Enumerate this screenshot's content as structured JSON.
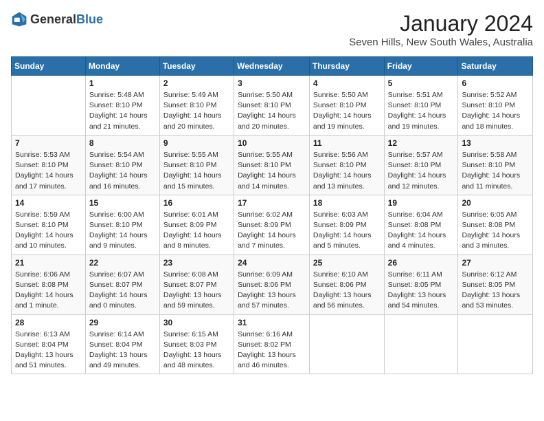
{
  "logo": {
    "general": "General",
    "blue": "Blue"
  },
  "title": "January 2024",
  "subtitle": "Seven Hills, New South Wales, Australia",
  "days_of_week": [
    "Sunday",
    "Monday",
    "Tuesday",
    "Wednesday",
    "Thursday",
    "Friday",
    "Saturday"
  ],
  "weeks": [
    [
      {
        "day": "",
        "info": ""
      },
      {
        "day": "1",
        "info": "Sunrise: 5:48 AM\nSunset: 8:10 PM\nDaylight: 14 hours\nand 21 minutes."
      },
      {
        "day": "2",
        "info": "Sunrise: 5:49 AM\nSunset: 8:10 PM\nDaylight: 14 hours\nand 20 minutes."
      },
      {
        "day": "3",
        "info": "Sunrise: 5:50 AM\nSunset: 8:10 PM\nDaylight: 14 hours\nand 20 minutes."
      },
      {
        "day": "4",
        "info": "Sunrise: 5:50 AM\nSunset: 8:10 PM\nDaylight: 14 hours\nand 19 minutes."
      },
      {
        "day": "5",
        "info": "Sunrise: 5:51 AM\nSunset: 8:10 PM\nDaylight: 14 hours\nand 19 minutes."
      },
      {
        "day": "6",
        "info": "Sunrise: 5:52 AM\nSunset: 8:10 PM\nDaylight: 14 hours\nand 18 minutes."
      }
    ],
    [
      {
        "day": "7",
        "info": "Sunrise: 5:53 AM\nSunset: 8:10 PM\nDaylight: 14 hours\nand 17 minutes."
      },
      {
        "day": "8",
        "info": "Sunrise: 5:54 AM\nSunset: 8:10 PM\nDaylight: 14 hours\nand 16 minutes."
      },
      {
        "day": "9",
        "info": "Sunrise: 5:55 AM\nSunset: 8:10 PM\nDaylight: 14 hours\nand 15 minutes."
      },
      {
        "day": "10",
        "info": "Sunrise: 5:55 AM\nSunset: 8:10 PM\nDaylight: 14 hours\nand 14 minutes."
      },
      {
        "day": "11",
        "info": "Sunrise: 5:56 AM\nSunset: 8:10 PM\nDaylight: 14 hours\nand 13 minutes."
      },
      {
        "day": "12",
        "info": "Sunrise: 5:57 AM\nSunset: 8:10 PM\nDaylight: 14 hours\nand 12 minutes."
      },
      {
        "day": "13",
        "info": "Sunrise: 5:58 AM\nSunset: 8:10 PM\nDaylight: 14 hours\nand 11 minutes."
      }
    ],
    [
      {
        "day": "14",
        "info": "Sunrise: 5:59 AM\nSunset: 8:10 PM\nDaylight: 14 hours\nand 10 minutes."
      },
      {
        "day": "15",
        "info": "Sunrise: 6:00 AM\nSunset: 8:10 PM\nDaylight: 14 hours\nand 9 minutes."
      },
      {
        "day": "16",
        "info": "Sunrise: 6:01 AM\nSunset: 8:09 PM\nDaylight: 14 hours\nand 8 minutes."
      },
      {
        "day": "17",
        "info": "Sunrise: 6:02 AM\nSunset: 8:09 PM\nDaylight: 14 hours\nand 7 minutes."
      },
      {
        "day": "18",
        "info": "Sunrise: 6:03 AM\nSunset: 8:09 PM\nDaylight: 14 hours\nand 5 minutes."
      },
      {
        "day": "19",
        "info": "Sunrise: 6:04 AM\nSunset: 8:08 PM\nDaylight: 14 hours\nand 4 minutes."
      },
      {
        "day": "20",
        "info": "Sunrise: 6:05 AM\nSunset: 8:08 PM\nDaylight: 14 hours\nand 3 minutes."
      }
    ],
    [
      {
        "day": "21",
        "info": "Sunrise: 6:06 AM\nSunset: 8:08 PM\nDaylight: 14 hours\nand 1 minute."
      },
      {
        "day": "22",
        "info": "Sunrise: 6:07 AM\nSunset: 8:07 PM\nDaylight: 14 hours\nand 0 minutes."
      },
      {
        "day": "23",
        "info": "Sunrise: 6:08 AM\nSunset: 8:07 PM\nDaylight: 13 hours\nand 59 minutes."
      },
      {
        "day": "24",
        "info": "Sunrise: 6:09 AM\nSunset: 8:06 PM\nDaylight: 13 hours\nand 57 minutes."
      },
      {
        "day": "25",
        "info": "Sunrise: 6:10 AM\nSunset: 8:06 PM\nDaylight: 13 hours\nand 56 minutes."
      },
      {
        "day": "26",
        "info": "Sunrise: 6:11 AM\nSunset: 8:05 PM\nDaylight: 13 hours\nand 54 minutes."
      },
      {
        "day": "27",
        "info": "Sunrise: 6:12 AM\nSunset: 8:05 PM\nDaylight: 13 hours\nand 53 minutes."
      }
    ],
    [
      {
        "day": "28",
        "info": "Sunrise: 6:13 AM\nSunset: 8:04 PM\nDaylight: 13 hours\nand 51 minutes."
      },
      {
        "day": "29",
        "info": "Sunrise: 6:14 AM\nSunset: 8:04 PM\nDaylight: 13 hours\nand 49 minutes."
      },
      {
        "day": "30",
        "info": "Sunrise: 6:15 AM\nSunset: 8:03 PM\nDaylight: 13 hours\nand 48 minutes."
      },
      {
        "day": "31",
        "info": "Sunrise: 6:16 AM\nSunset: 8:02 PM\nDaylight: 13 hours\nand 46 minutes."
      },
      {
        "day": "",
        "info": ""
      },
      {
        "day": "",
        "info": ""
      },
      {
        "day": "",
        "info": ""
      }
    ]
  ]
}
